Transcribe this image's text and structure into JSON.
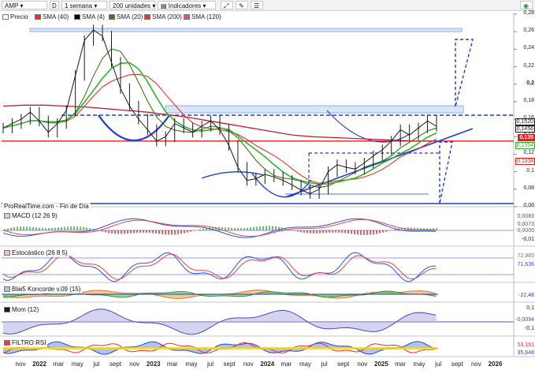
{
  "toolbar": {
    "symbol": "AMP",
    "marker": "D",
    "timeframe": "1 semana",
    "units": "200 unidades",
    "indicators": "Indicadores"
  },
  "legend": [
    {
      "label": "Precio",
      "color": "#1a1a1a"
    },
    {
      "label": "SMA (40)",
      "color": "#e8322a"
    },
    {
      "label": "SMA (4)",
      "color": "#000000"
    },
    {
      "label": "SMA (20)",
      "color": "#3c7a1f"
    },
    {
      "label": "SMA (200)",
      "color": "#e8322a"
    },
    {
      "label": "SMA (120)",
      "color": "#ee4a7a"
    }
  ],
  "price_axis": {
    "ticks": [
      "0,28",
      "0,26",
      "0,24",
      "0,22",
      "0,2",
      "0,18",
      "0,16",
      "0,14",
      "0,12",
      "0,1",
      "0,08",
      "0,06"
    ],
    "tags": [
      {
        "text": "0,1520",
        "color": "#1a1a1a"
      },
      {
        "text": "0,1456",
        "color": "#1a1a1a"
      },
      {
        "text": "0,135",
        "color": "#e02020"
      },
      {
        "text": "0,1354",
        "color": "#2db52d"
      },
      {
        "text": "0,1108",
        "color": "#e02020"
      }
    ]
  },
  "source": "ProRealTime.com - Fin de Día",
  "panels": {
    "macd": {
      "title": "MACD (12 26 9)",
      "ticks": [
        "0,0083",
        "0,0073",
        "-0,0000",
        "-0,01"
      ]
    },
    "stoch": {
      "title": "Estocástico (26 8 5)",
      "ticks": [
        "72,965",
        "71,636"
      ]
    },
    "blai": {
      "title": "Blai5 Koncorde v.09 (15)",
      "ticks": [
        "-22,48"
      ]
    },
    "mom": {
      "title": "Mom (12)",
      "ticks": [
        "0,1",
        "-0,0094",
        "-0,1"
      ]
    },
    "rsi": {
      "title": "FILTRO RSI",
      "ticks": [
        "53,161",
        "35,648"
      ]
    }
  },
  "x_axis": [
    {
      "label": "nov",
      "year": false
    },
    {
      "label": "2022",
      "year": true
    },
    {
      "label": "mar",
      "year": false
    },
    {
      "label": "may",
      "year": false
    },
    {
      "label": "jul",
      "year": false
    },
    {
      "label": "sept",
      "year": false
    },
    {
      "label": "nov",
      "year": false
    },
    {
      "label": "2023",
      "year": true
    },
    {
      "label": "mar",
      "year": false
    },
    {
      "label": "may",
      "year": false
    },
    {
      "label": "jul",
      "year": false
    },
    {
      "label": "sept",
      "year": false
    },
    {
      "label": "nov",
      "year": false
    },
    {
      "label": "2024",
      "year": true
    },
    {
      "label": "mar",
      "year": false
    },
    {
      "label": "may",
      "year": false
    },
    {
      "label": "jul",
      "year": false
    },
    {
      "label": "sept",
      "year": false
    },
    {
      "label": "nov",
      "year": false
    },
    {
      "label": "2025",
      "year": true
    },
    {
      "label": "mar",
      "year": false
    },
    {
      "label": "may",
      "year": false
    },
    {
      "label": "jul",
      "year": false
    },
    {
      "label": "sept",
      "year": false
    },
    {
      "label": "nov",
      "year": false
    },
    {
      "label": "2026",
      "year": true
    }
  ],
  "chart_data": {
    "type": "line",
    "y_range": [
      0.06,
      0.28
    ],
    "price_approx": [
      0.15,
      0.155,
      0.16,
      0.168,
      0.158,
      0.145,
      0.155,
      0.17,
      0.21,
      0.25,
      0.262,
      0.255,
      0.225,
      0.195,
      0.175,
      0.16,
      0.148,
      0.135,
      0.14,
      0.155,
      0.15,
      0.145,
      0.152,
      0.158,
      0.148,
      0.13,
      0.105,
      0.09,
      0.092,
      0.097,
      0.094,
      0.09,
      0.085,
      0.079,
      0.075,
      0.08,
      0.1,
      0.108,
      0.105,
      0.103,
      0.11,
      0.118,
      0.125,
      0.135,
      0.148,
      0.142,
      0.15,
      0.158,
      0.152
    ],
    "sma200_approx": [
      0.175,
      0.176,
      0.176,
      0.175,
      0.174,
      0.172,
      0.17,
      0.168,
      0.165,
      0.162,
      0.158,
      0.154,
      0.15,
      0.146,
      0.142,
      0.14,
      0.139,
      0.138,
      0.137,
      0.136,
      0.135,
      0.135
    ],
    "horizontal_levels": [
      0.15,
      0.135,
      0.06
    ]
  }
}
